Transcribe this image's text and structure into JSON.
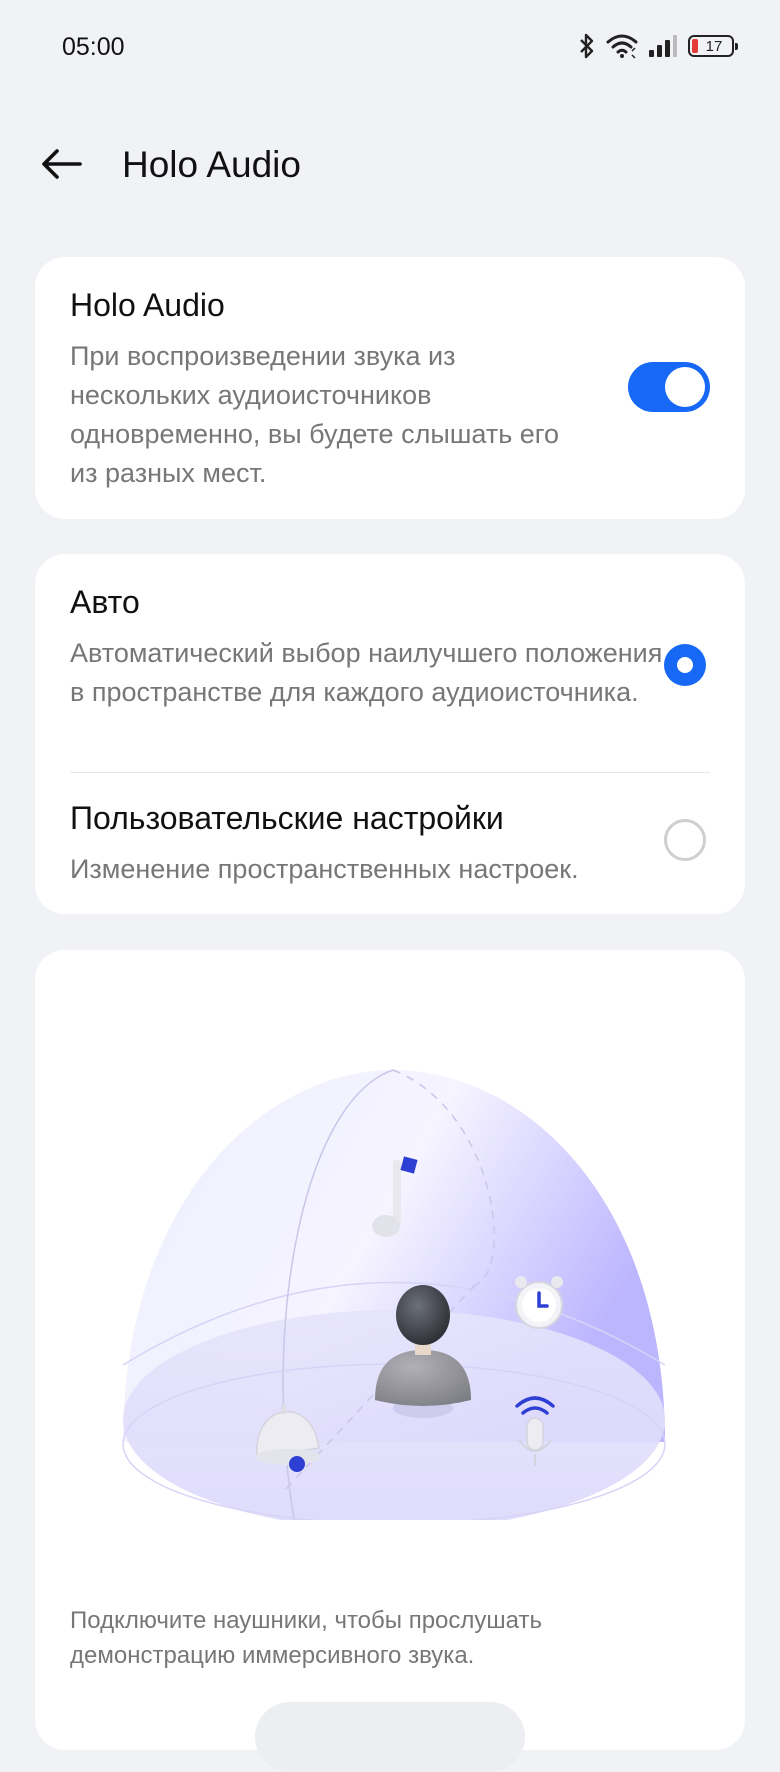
{
  "status_bar": {
    "time": "05:00",
    "battery_level": "17",
    "icons": [
      "bluetooth-icon",
      "wifi-icon",
      "signal-icon",
      "battery-icon"
    ]
  },
  "header": {
    "title": "Holo Audio",
    "back_icon": "arrow-left-icon"
  },
  "holo_audio": {
    "title": "Holo Audio",
    "description": "При воспроизведении звука из нескольких аудиоисточников одновременно, вы будете слышать его из разных мест.",
    "enabled": true
  },
  "mode": {
    "auto": {
      "title": "Авто",
      "description": "Автоматический выбор наилучшего положения в пространстве для каждого аудиоисточника.",
      "selected": true
    },
    "custom": {
      "title": "Пользовательские настройки",
      "description": "Изменение пространственных настроек.",
      "selected": false
    }
  },
  "demo": {
    "illustration_icons": [
      "music-note-icon",
      "alarm-clock-icon",
      "bell-icon",
      "microphone-icon",
      "user-avatar-icon"
    ],
    "hint": "Подключите наушники, чтобы прослушать демонстрацию иммерсивного звука."
  },
  "colors": {
    "accent": "#1668f5",
    "background": "#f1f2f5",
    "card": "#ffffff",
    "battery_low": "#e53935"
  }
}
